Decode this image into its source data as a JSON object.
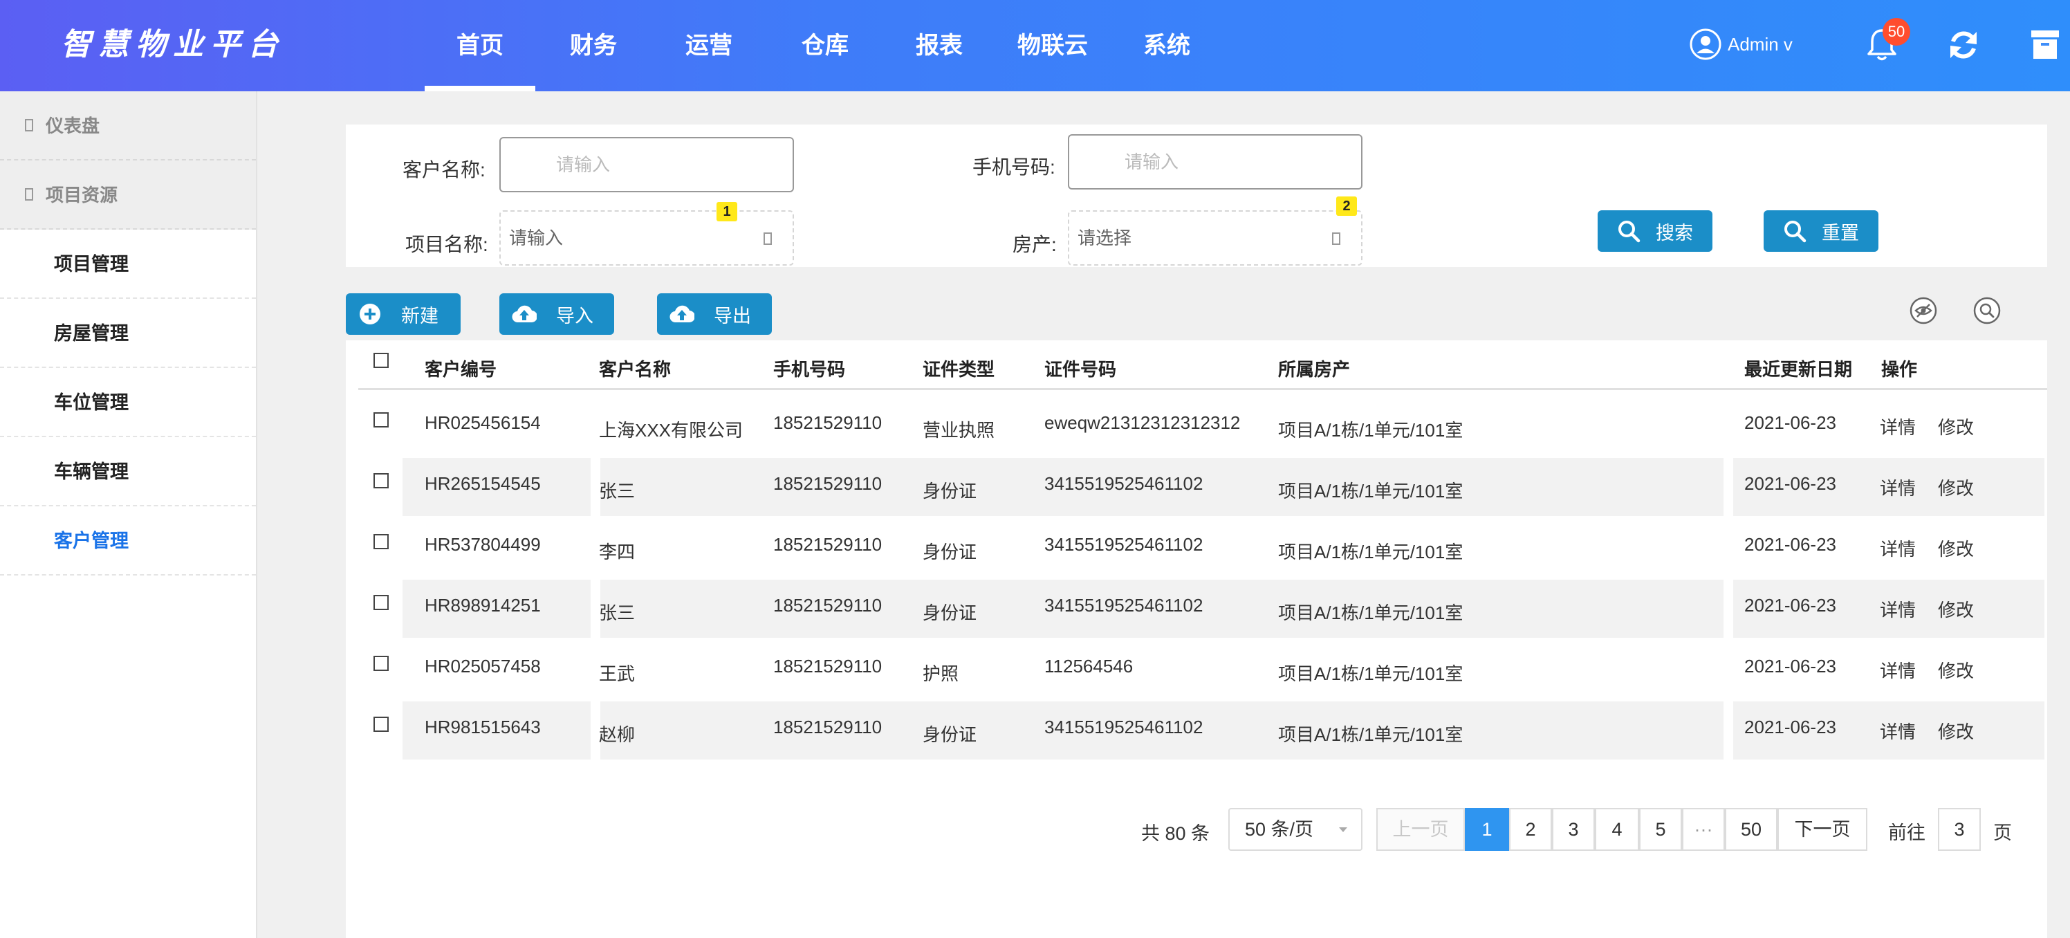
{
  "header": {
    "logo": "智慧物业平台",
    "nav": [
      {
        "label": "首页",
        "active": true
      },
      {
        "label": "财务"
      },
      {
        "label": "运营"
      },
      {
        "label": "仓库"
      },
      {
        "label": "报表"
      },
      {
        "label": "物联云"
      },
      {
        "label": "系统"
      }
    ],
    "user": "Admin v",
    "notification_count": "50"
  },
  "sidebar": {
    "groups": [
      "仪表盘",
      "项目资源"
    ],
    "items": [
      {
        "label": "项目管理"
      },
      {
        "label": "房屋管理"
      },
      {
        "label": "车位管理"
      },
      {
        "label": "车辆管理"
      },
      {
        "label": "客户管理",
        "active": true
      }
    ]
  },
  "search": {
    "customer_name_label": "客户名称:",
    "customer_name_placeholder": "请输入",
    "phone_label": "手机号码:",
    "phone_placeholder": "请输入",
    "project_label": "项目名称:",
    "project_placeholder": "请输入",
    "project_tag": "1",
    "property_label": "房产:",
    "property_placeholder": "请选择",
    "property_tag": "2",
    "search_button": "搜索",
    "reset_button": "重置"
  },
  "toolbar": {
    "new": "新建",
    "import": "导入",
    "export": "导出"
  },
  "table": {
    "columns": [
      "客户编号",
      "客户名称",
      "手机号码",
      "证件类型",
      "证件号码",
      "所属房产",
      "最近更新日期",
      "操作"
    ],
    "rows": [
      {
        "id": "HR025456154",
        "name": "上海XXX有限公司",
        "phone": "18521529110",
        "doc_type": "营业执照",
        "doc_no": "eweqw21312312312312",
        "property": "项目A/1栋/1单元/101室",
        "date": "2021-06-23"
      },
      {
        "id": "HR265154545",
        "name": "张三",
        "phone": "18521529110",
        "doc_type": "身份证",
        "doc_no": "3415519525461102",
        "property": "项目A/1栋/1单元/101室",
        "date": "2021-06-23"
      },
      {
        "id": "HR537804499",
        "name": "李四",
        "phone": "18521529110",
        "doc_type": "身份证",
        "doc_no": "3415519525461102",
        "property": "项目A/1栋/1单元/101室",
        "date": "2021-06-23"
      },
      {
        "id": "HR898914251",
        "name": "张三",
        "phone": "18521529110",
        "doc_type": "身份证",
        "doc_no": "3415519525461102",
        "property": "项目A/1栋/1单元/101室",
        "date": "2021-06-23"
      },
      {
        "id": "HR025057458",
        "name": "王武",
        "phone": "18521529110",
        "doc_type": "护照",
        "doc_no": "112564546",
        "property": "项目A/1栋/1单元/101室",
        "date": "2021-06-23"
      },
      {
        "id": "HR981515643",
        "name": "赵柳",
        "phone": "18521529110",
        "doc_type": "身份证",
        "doc_no": "3415519525461102",
        "property": "项目A/1栋/1单元/101室",
        "date": "2021-06-23"
      }
    ],
    "action_detail": "详情",
    "action_edit": "修改"
  },
  "pagination": {
    "total": "共 80 条",
    "page_size": "50 条/页",
    "prev": "上一页",
    "pages": [
      "1",
      "2",
      "3",
      "4",
      "5"
    ],
    "ellipsis": "···",
    "last": "50",
    "next": "下一页",
    "goto_label": "前往",
    "goto_value": "3",
    "page_unit": "页",
    "current": "1"
  },
  "colors": {
    "header_gradient_start": "#5b5ff3",
    "header_gradient_end": "#2f8efb",
    "button_blue": "#1b8ec8",
    "active_blue": "#1a73e8",
    "page_active": "#2f95f0",
    "badge_red": "#ff4d2e",
    "tag_yellow": "#ffe81a"
  }
}
